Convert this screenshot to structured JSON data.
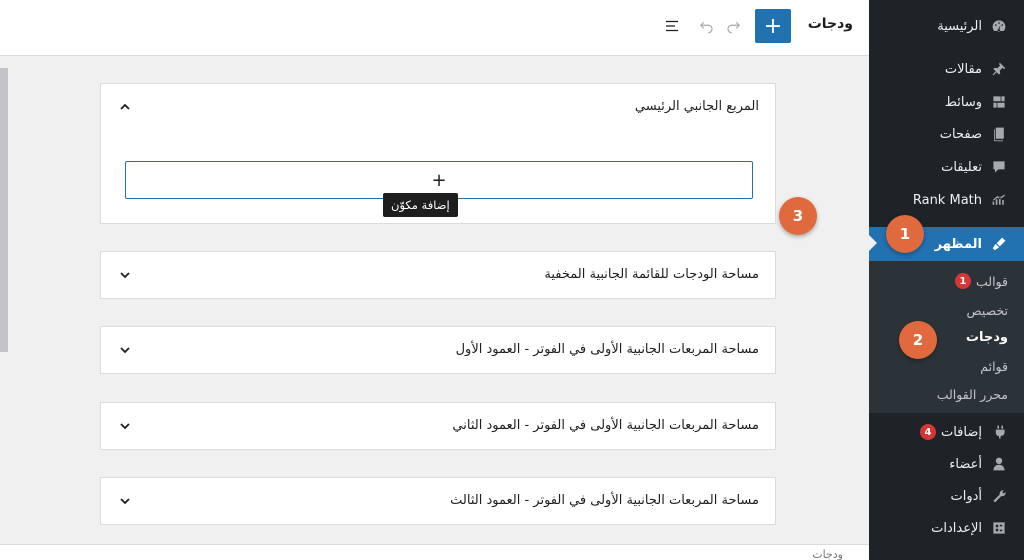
{
  "header": {
    "title": "ودجات",
    "add_label": "+"
  },
  "sidebar": {
    "items": [
      {
        "label": "الرئيسية",
        "icon": "dashboard-icon"
      },
      {
        "label": "مقالات",
        "icon": "pin-icon"
      },
      {
        "label": "وسائط",
        "icon": "media-icon"
      },
      {
        "label": "صفحات",
        "icon": "page-icon"
      },
      {
        "label": "تعليقات",
        "icon": "comment-icon"
      },
      {
        "label": "Rank Math",
        "icon": "rank-math-icon"
      },
      {
        "label": "المظهر",
        "icon": "appearance-icon"
      },
      {
        "label": "إضافات",
        "icon": "plugin-icon",
        "badge": "4"
      },
      {
        "label": "أعضاء",
        "icon": "users-icon"
      },
      {
        "label": "أدوات",
        "icon": "tools-icon"
      },
      {
        "label": "الإعدادات",
        "icon": "settings-icon"
      }
    ],
    "submenu": [
      {
        "label": "قوالب",
        "badge": "1"
      },
      {
        "label": "تخصيص"
      },
      {
        "label": "ودجات"
      },
      {
        "label": "قوائم"
      },
      {
        "label": "محرر القوالب"
      }
    ]
  },
  "callouts": [
    "1",
    "2",
    "3"
  ],
  "panels": [
    {
      "title": "المربع الجانبي الرئيسي",
      "expanded": true
    },
    {
      "title": "مساحة الودجات للقائمة الجانبية المخفية",
      "expanded": false
    },
    {
      "title": "مساحة المربعات الجانبية الأولى في الفوتر - العمود الأول",
      "expanded": false
    },
    {
      "title": "مساحة المربعات الجانبية الأولى في الفوتر - العمود الثاني",
      "expanded": false
    },
    {
      "title": "مساحة المربعات الجانبية الأولى في الفوتر - العمود الثالث",
      "expanded": false
    }
  ],
  "appender": {
    "symbol": "+",
    "tooltip": "إضافة مكوّن"
  },
  "statusbar": {
    "text": "ودجات"
  },
  "colors": {
    "accent": "#2271b1",
    "sidebar": "#1d2327",
    "submenu": "#2c3338",
    "callout": "#e06a3d",
    "badge": "#d63638"
  }
}
